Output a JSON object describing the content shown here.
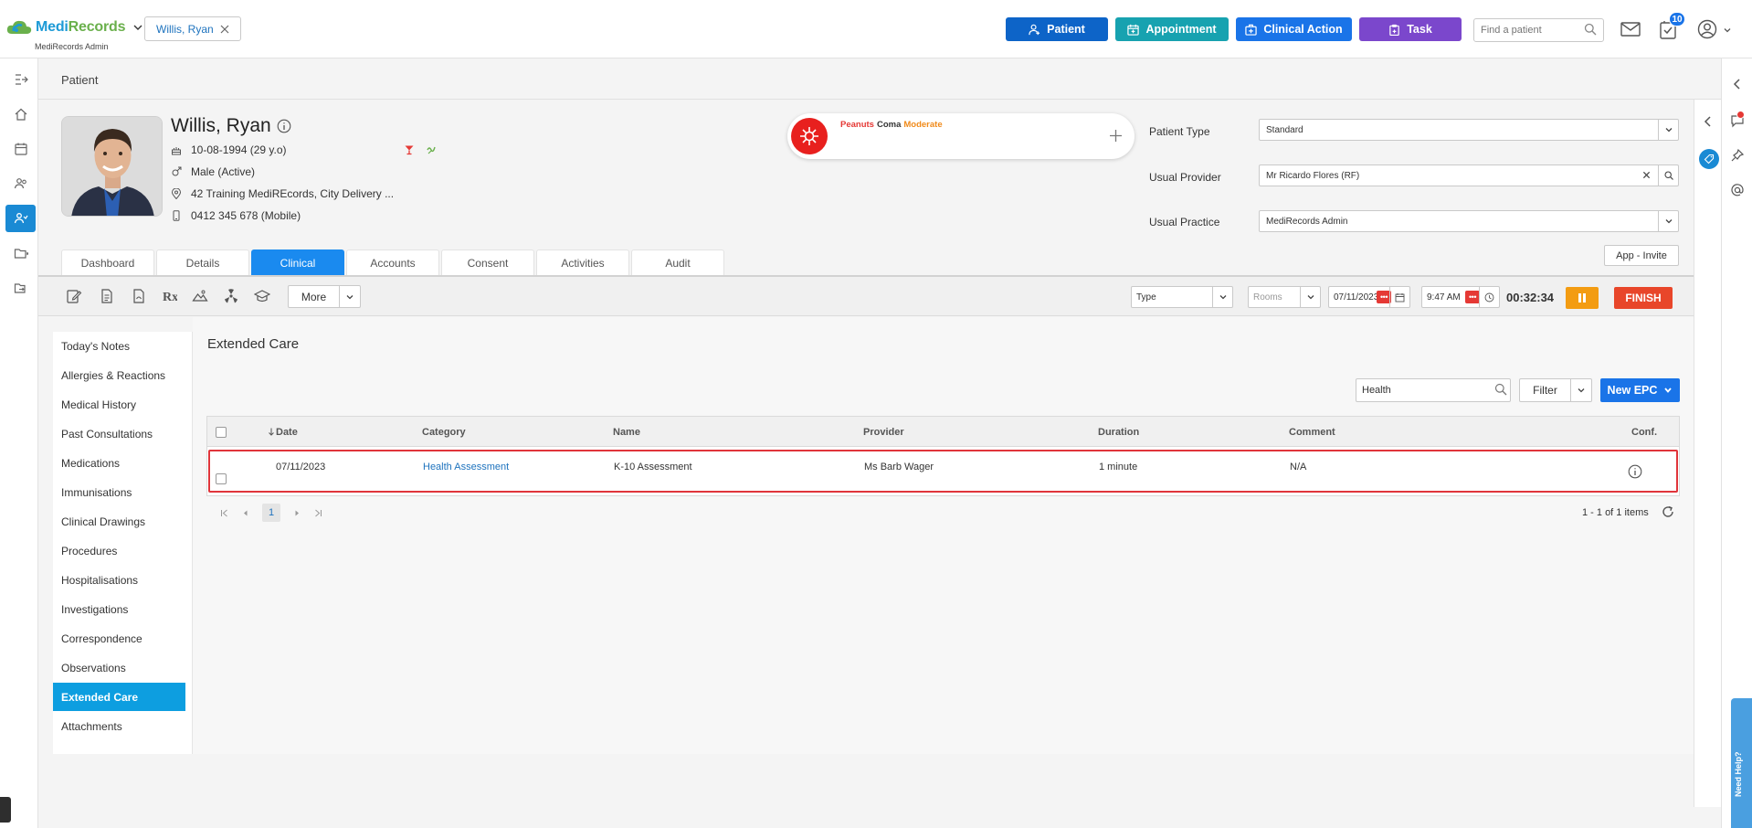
{
  "header": {
    "logo": {
      "part1": "Medi",
      "part2": "Records",
      "subtitle": "MediRecords Admin"
    },
    "open_patient_tab": "Willis, Ryan",
    "buttons": {
      "patient": "Patient",
      "appointment": "Appointment",
      "clinical_action": "Clinical Action",
      "task": "Task"
    },
    "find_patient_placeholder": "Find a patient",
    "task_badge": "10"
  },
  "page_title": "Patient",
  "patient": {
    "name": "Willis, Ryan",
    "dob": "10-08-1994 (29 y.o)",
    "gender": "Male (Active)",
    "address": "42 Training MediREcords, City Delivery ...",
    "phone": "0412 345 678 (Mobile)"
  },
  "allergy": {
    "substance": "Peanuts",
    "reaction": "Coma",
    "severity": "Moderate"
  },
  "fields": {
    "patient_type": {
      "label": "Patient Type",
      "value": "Standard"
    },
    "usual_provider": {
      "label": "Usual Provider",
      "value": "Mr Ricardo Flores (RF)"
    },
    "usual_practice": {
      "label": "Usual Practice",
      "value": "MediRecords Admin"
    }
  },
  "app_invite": "App - Invite",
  "tabs": [
    {
      "label": "Dashboard",
      "active": false
    },
    {
      "label": "Details",
      "active": false
    },
    {
      "label": "Clinical",
      "active": true
    },
    {
      "label": "Accounts",
      "active": false
    },
    {
      "label": "Consent",
      "active": false
    },
    {
      "label": "Activities",
      "active": false
    },
    {
      "label": "Audit",
      "active": false
    }
  ],
  "toolbar": {
    "more_label": "More",
    "type_placeholder": "Type",
    "rooms_placeholder": "Rooms",
    "date": "07/11/2023",
    "time": "9:47 AM",
    "timer": "00:32:34",
    "finish_label": "FINISH"
  },
  "subnav": [
    {
      "label": "Today's Notes",
      "active": false
    },
    {
      "label": "Allergies & Reactions",
      "active": false
    },
    {
      "label": "Medical History",
      "active": false
    },
    {
      "label": "Past Consultations",
      "active": false
    },
    {
      "label": "Medications",
      "active": false
    },
    {
      "label": "Immunisations",
      "active": false
    },
    {
      "label": "Clinical Drawings",
      "active": false
    },
    {
      "label": "Procedures",
      "active": false
    },
    {
      "label": "Hospitalisations",
      "active": false
    },
    {
      "label": "Investigations",
      "active": false
    },
    {
      "label": "Correspondence",
      "active": false
    },
    {
      "label": "Observations",
      "active": false
    },
    {
      "label": "Extended Care",
      "active": true
    },
    {
      "label": "Attachments",
      "active": false
    }
  ],
  "section": {
    "title": "Extended Care",
    "search_value": "Health",
    "filter_label": "Filter",
    "new_button": "New EPC"
  },
  "grid": {
    "columns": [
      "Date",
      "Category",
      "Name",
      "Provider",
      "Duration",
      "Comment",
      "Conf."
    ],
    "rows": [
      {
        "date": "07/11/2023",
        "category": "Health Assessment",
        "name": "K-10 Assessment",
        "provider": "Ms Barb Wager",
        "duration": "1 minute",
        "comment": "N/A"
      }
    ],
    "current_page": "1",
    "items_summary": "1 - 1 of 1 items"
  },
  "need_help": "Need Help?",
  "colors": {
    "primary": "#1a74e8",
    "active_tab": "#1a8aef",
    "highlight": "#e0353b",
    "allergy": "#e8201e"
  }
}
